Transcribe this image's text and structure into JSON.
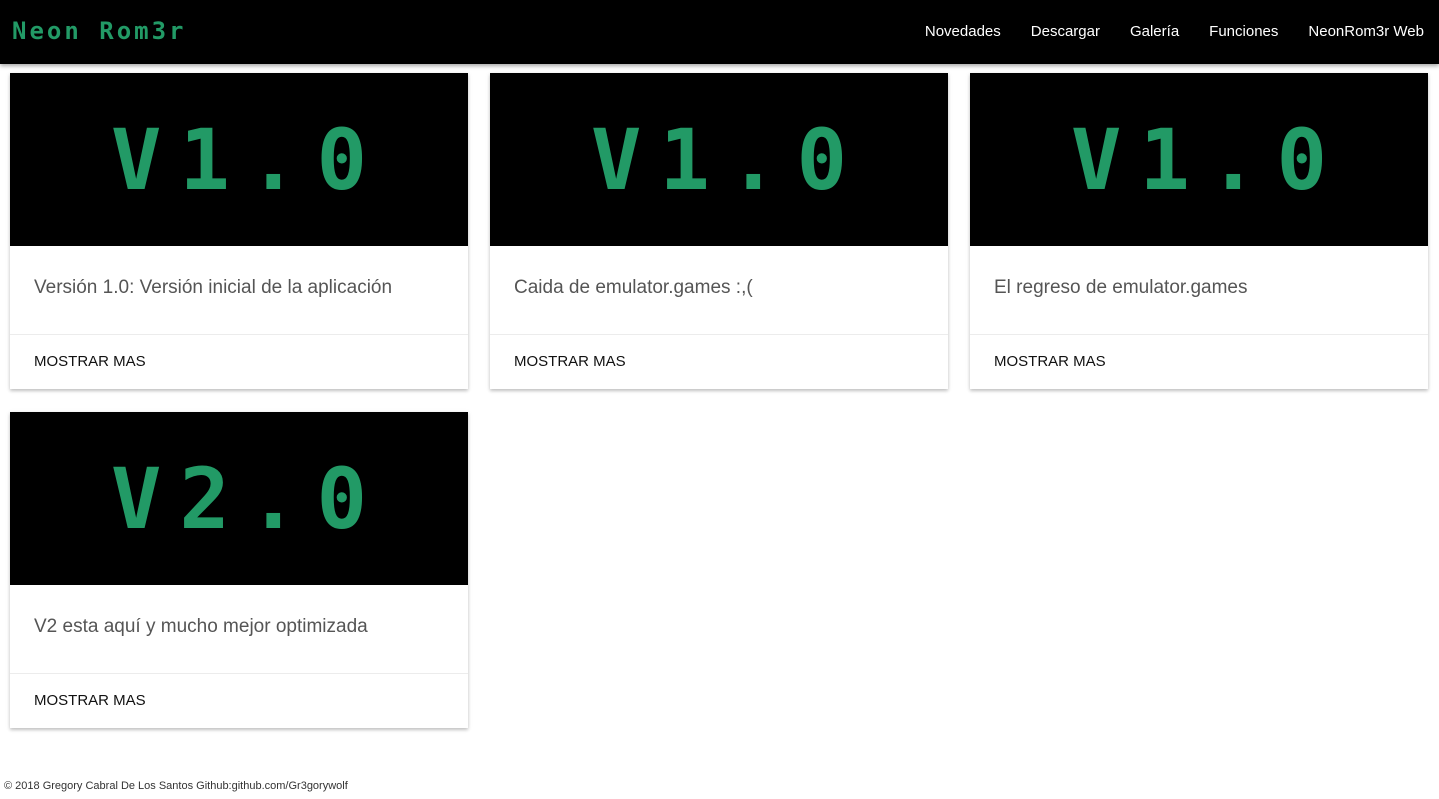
{
  "navbar": {
    "brand": "Neon Rom3r",
    "links": [
      "Novedades",
      "Descargar",
      "Galería",
      "Funciones",
      "NeonRom3r Web"
    ]
  },
  "cards": [
    {
      "version": "V1.0",
      "text": "Versión 1.0: Versión inicial de la aplicación",
      "action": "MOSTRAR MAS"
    },
    {
      "version": "V1.0",
      "text": "Caida de emulator.games :,(",
      "action": "MOSTRAR MAS"
    },
    {
      "version": "V1.0",
      "text": "El regreso de emulator.games",
      "action": "MOSTRAR MAS"
    },
    {
      "version": "V2.0",
      "text": "V2 esta aquí y mucho mejor optimizada",
      "action": "MOSTRAR MAS"
    }
  ],
  "footer": {
    "text": "© 2018 Gregory Cabral De Los Santos Github:github.com/Gr3gorywolf"
  },
  "colors": {
    "accent": "#229a66",
    "navbar_bg": "#000000",
    "card_image_bg": "#000000"
  }
}
